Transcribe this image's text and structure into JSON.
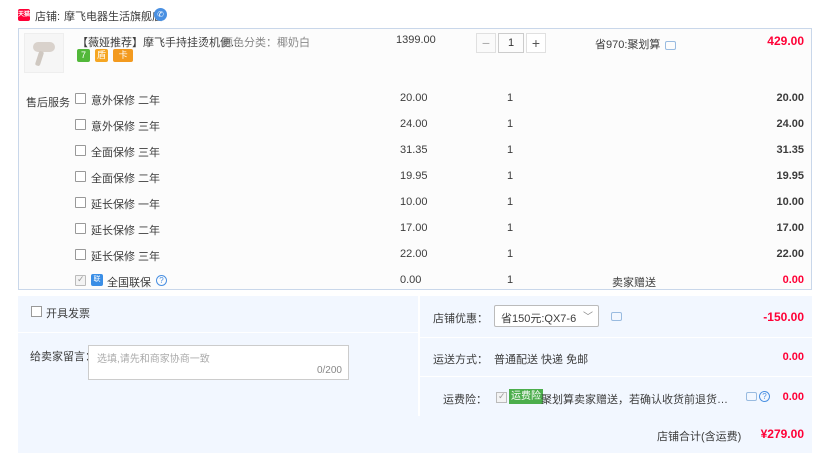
{
  "shop": {
    "badge": "天猫",
    "prefix": "店铺:",
    "name": "摩飞电器生活旗舰店",
    "contact_icon": "wangwang-icon"
  },
  "product": {
    "image_icon": "steamer-icon",
    "title": "【薇娅推荐】摩飞手持挂烫机便...",
    "sku": "颜色分类：椰奶白",
    "tags": [
      "7",
      "盾",
      "卡"
    ],
    "price": "1399.00",
    "quantity": "1",
    "qty_minus": "−",
    "qty_plus": "+",
    "discount": "省970:聚划算",
    "total": "429.00"
  },
  "services": {
    "label": "售后服务",
    "items": [
      {
        "name": "意外保修 二年",
        "price": "20.00",
        "qty": "1",
        "amount": "20.00",
        "checked": false
      },
      {
        "name": "意外保修 三年",
        "price": "24.00",
        "qty": "1",
        "amount": "24.00",
        "checked": false
      },
      {
        "name": "全面保修 三年",
        "price": "31.35",
        "qty": "1",
        "amount": "31.35",
        "checked": false
      },
      {
        "name": "全面保修 二年",
        "price": "19.95",
        "qty": "1",
        "amount": "19.95",
        "checked": false
      },
      {
        "name": "延长保修 一年",
        "price": "10.00",
        "qty": "1",
        "amount": "10.00",
        "checked": false
      },
      {
        "name": "延长保修 二年",
        "price": "17.00",
        "qty": "1",
        "amount": "17.00",
        "checked": false
      },
      {
        "name": "延长保修 三年",
        "price": "22.00",
        "qty": "1",
        "amount": "22.00",
        "checked": false
      }
    ],
    "guarantee": {
      "icon": "联",
      "name": "全国联保",
      "price": "0.00",
      "qty": "1",
      "tip": "卖家赠送",
      "amount": "0.00",
      "checked": true
    }
  },
  "invoice": {
    "label": "开具发票"
  },
  "message": {
    "label": "给卖家留言：",
    "placeholder": "选填,请先和商家协商一致",
    "counter": "0/200"
  },
  "shop_discount": {
    "label": "店铺优惠：",
    "selected": "省150元:QX7-6",
    "amount": "-150.00"
  },
  "shipping": {
    "label": "运送方式：",
    "value": "普通配送 快递 免邮",
    "amount": "0.00"
  },
  "insurance": {
    "label": "运费险：",
    "badge": "运费险",
    "text": "聚划算卖家赠送，若确认收货前退货，可获...",
    "amount": "0.00"
  },
  "summary": {
    "label": "店铺合计(含运费)",
    "amount": "¥279.00"
  },
  "colors": {
    "accent": "#ff0036",
    "panel": "#f2f7ff",
    "border": "#c9d7ea"
  }
}
